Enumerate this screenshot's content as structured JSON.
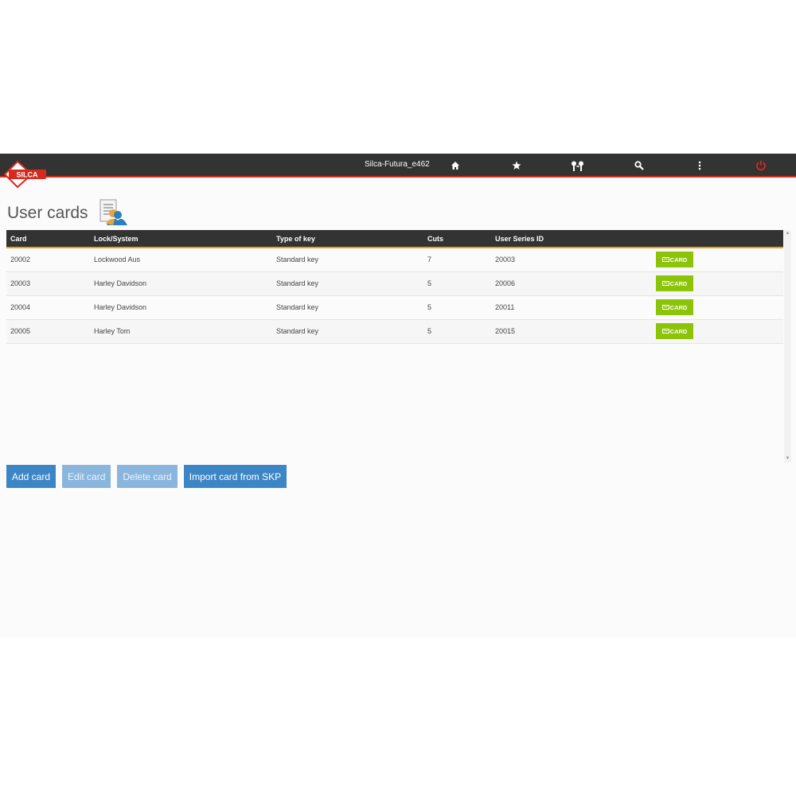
{
  "header": {
    "device_name": "Silca-Futura_e462",
    "logo_text": "SILCA",
    "nav_icons": [
      "home-icon",
      "star-icon",
      "keys-icon",
      "search-icon",
      "more-vertical-icon",
      "power-icon"
    ],
    "accent_color": "#d52b1e"
  },
  "page": {
    "title": "User cards",
    "title_icon": "user-card-icon"
  },
  "table": {
    "columns": [
      "Card",
      "Lock/System",
      "Type of key",
      "Cuts",
      "User Series ID",
      ""
    ],
    "rows": [
      {
        "card": "20002",
        "lock": "Lockwood Aus",
        "type": "Standard key",
        "cuts": "7",
        "series": "20003",
        "action": "CARD"
      },
      {
        "card": "20003",
        "lock": "Harley Davidson",
        "type": "Standard key",
        "cuts": "5",
        "series": "20006",
        "action": "CARD"
      },
      {
        "card": "20004",
        "lock": "Harley Davidson",
        "type": "Standard key",
        "cuts": "5",
        "series": "20011",
        "action": "CARD"
      },
      {
        "card": "20005",
        "lock": "Harley Tom",
        "type": "Standard key",
        "cuts": "5",
        "series": "20015",
        "action": "CARD"
      }
    ],
    "action_color": "#8cc40a"
  },
  "actions": {
    "add": "Add card",
    "edit": "Edit card",
    "delete": "Delete card",
    "import": "Import card from SKP"
  }
}
